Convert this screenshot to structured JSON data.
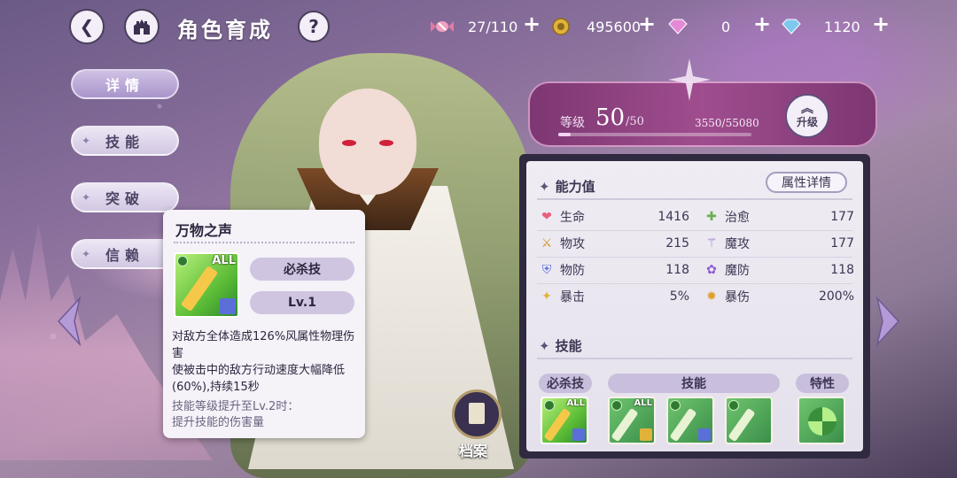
{
  "header": {
    "title": "角色育成",
    "back_icon": "back-icon",
    "home_icon": "castle-icon",
    "help_icon": "?"
  },
  "resources": {
    "stamina": "27/110",
    "gold": "495600",
    "gems_a": "0",
    "gems_b": "1120"
  },
  "side_tabs": [
    "详情",
    "技能",
    "突破",
    "信赖"
  ],
  "level": {
    "label": "等级",
    "value": "50",
    "max": "/50",
    "exp": "3550/55080",
    "exp_fraction": 0.064,
    "upgrade_label": "升级"
  },
  "stats": {
    "section_title": "能力值",
    "detail_button": "属性详情",
    "rows": [
      {
        "name": "生命",
        "value": "1416"
      },
      {
        "name": "治愈",
        "value": "177"
      },
      {
        "name": "物攻",
        "value": "215"
      },
      {
        "name": "魔攻",
        "value": "177"
      },
      {
        "name": "物防",
        "value": "118"
      },
      {
        "name": "魔防",
        "value": "118"
      },
      {
        "name": "暴击",
        "value": "5%"
      },
      {
        "name": "暴伤",
        "value": "200%"
      }
    ],
    "skills_title": "技能",
    "skill_headers": {
      "ult": "必杀技",
      "skill": "技能",
      "trait": "特性"
    },
    "skill_icon_all": "ALL"
  },
  "tooltip": {
    "title": "万物之声",
    "type": "必杀技",
    "level": "Lv.1",
    "icon_all": "ALL",
    "description": "对敌方全体造成126%风属性物理伤害\n使被击中的敌方行动速度大幅降低(60%),持续15秒",
    "upgrade_note": "技能等级提升至Lv.2时：\n提升技能的伤害量"
  },
  "file_button": "档案",
  "colors": {
    "accent_purple": "#9f4d8e",
    "panel_dark": "#2f2a40",
    "panel_light": "#efecf3",
    "skill_green": "#5dbd37"
  }
}
